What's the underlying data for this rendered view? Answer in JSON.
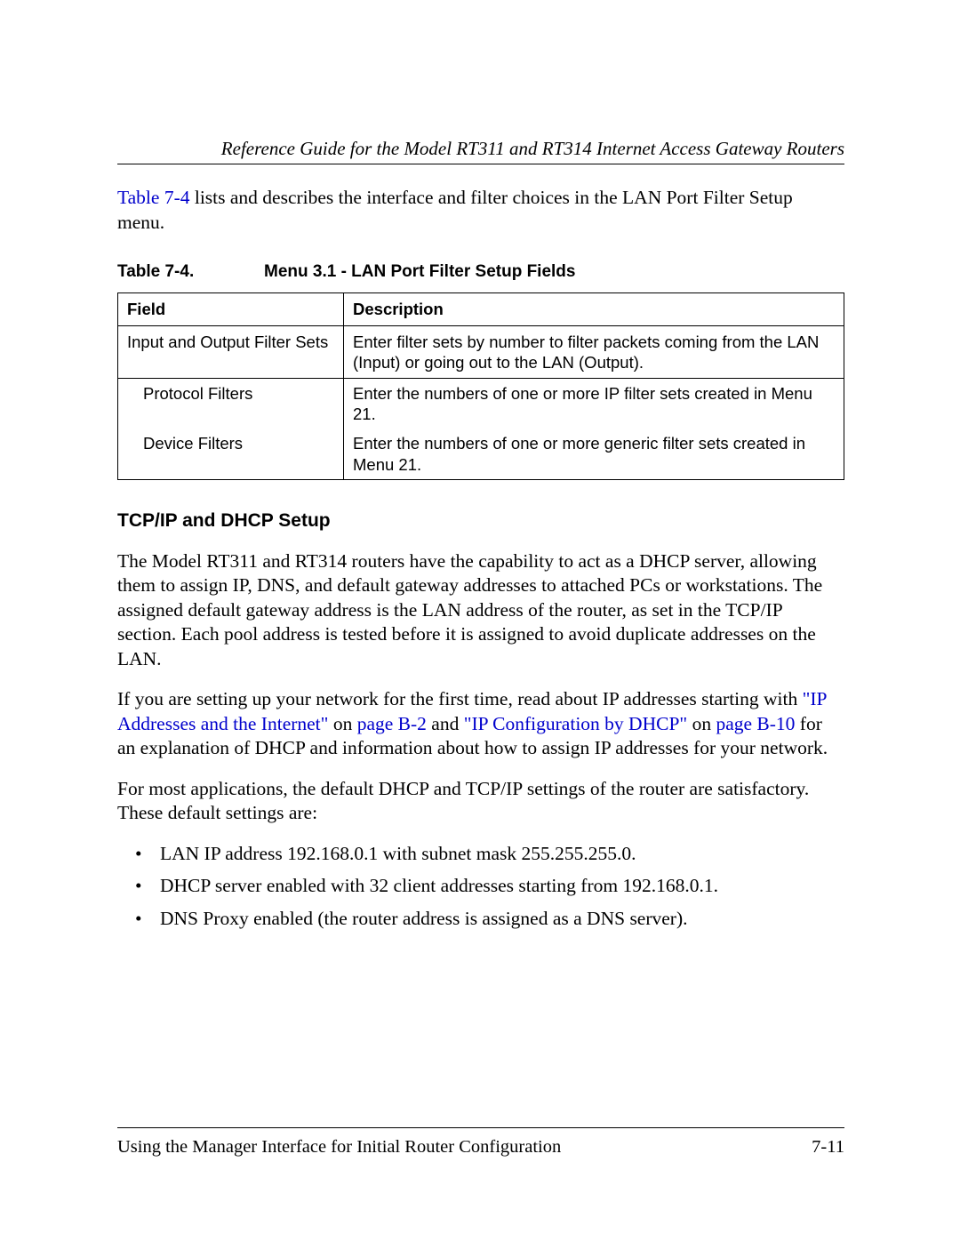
{
  "header": {
    "running_head": "Reference Guide for the Model RT311 and RT314 Internet Access Gateway Routers"
  },
  "intro": {
    "link": "Table 7-4",
    "rest": " lists and describes the interface and filter choices in the LAN Port Filter Setup menu."
  },
  "table": {
    "caption_num": "Table 7-4.",
    "caption_title": "Menu 3.1 - LAN Port Filter Setup Fields",
    "head_field": "Field",
    "head_desc": "Description",
    "rows": [
      {
        "field": "Input and Output Filter Sets",
        "desc": "Enter filter sets by number to filter packets coming from the LAN (Input) or going out to the LAN (Output)."
      },
      {
        "field": "Protocol Filters",
        "desc": "Enter the numbers of one or more IP filter sets created in Menu 21."
      },
      {
        "field": "Device Filters",
        "desc": "Enter the numbers of one or more generic filter sets created in Menu 21."
      }
    ]
  },
  "section": {
    "heading": "TCP/IP and DHCP Setup",
    "p1": "The Model RT311 and RT314 routers have the capability to act as a DHCP server, allowing them to assign IP, DNS, and default gateway addresses to attached PCs or workstations. The assigned default gateway address is the LAN address of the router, as set in the TCP/IP section. Each pool address is tested before it is assigned to avoid duplicate addresses on the LAN.",
    "p2_pre": "If you are setting up your network for the first time, read about IP addresses starting with ",
    "p2_link1": "\"IP Addresses and the Internet\"",
    "p2_mid1": " on ",
    "p2_link2": "page B-2",
    "p2_mid2": " and ",
    "p2_link3": "\"IP Configuration by DHCP\"",
    "p2_mid3": " on ",
    "p2_link4": "page B-10",
    "p2_post": " for an explanation of DHCP and information about how to assign IP addresses for your network.",
    "p3": "For most applications, the default DHCP and TCP/IP settings of the router are satisfactory. These default settings are:",
    "bullets": [
      "LAN IP address 192.168.0.1 with subnet mask 255.255.255.0.",
      "DHCP server enabled with 32 client addresses starting from 192.168.0.1.",
      "DNS Proxy enabled (the router address is assigned as a DNS server)."
    ]
  },
  "footer": {
    "left": "Using the Manager Interface for Initial Router Configuration",
    "right": "7-11"
  }
}
